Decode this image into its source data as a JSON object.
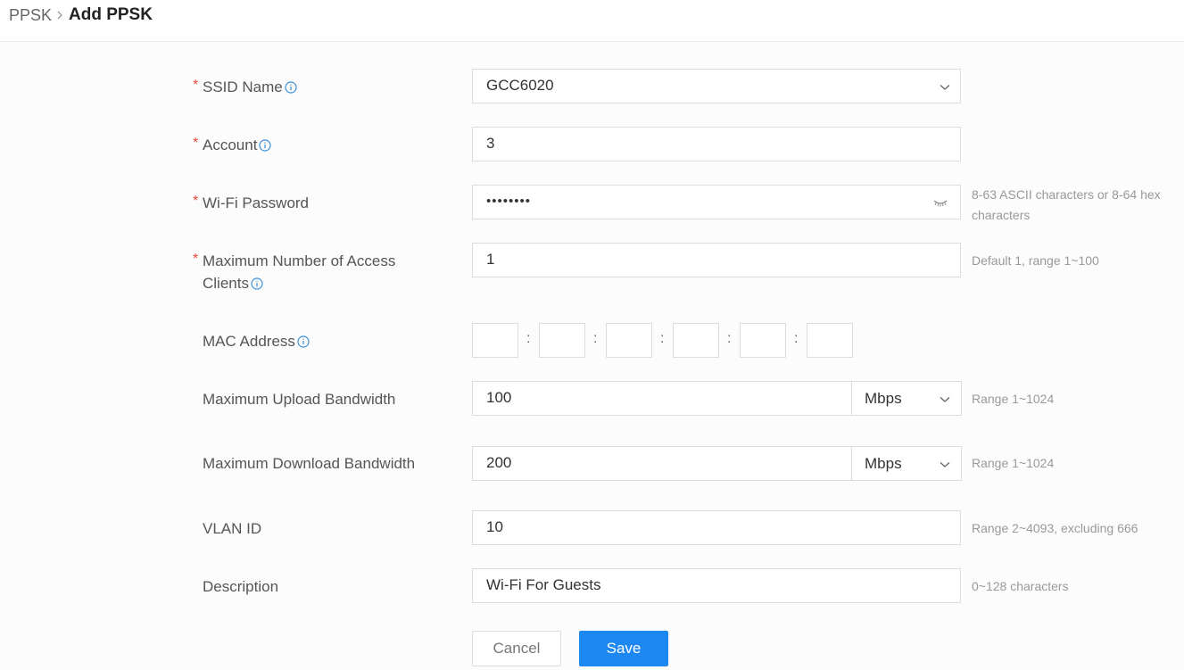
{
  "breadcrumb": {
    "root": "PPSK",
    "current": "Add PPSK"
  },
  "form": {
    "ssid_name": {
      "label": "SSID Name",
      "value": "GCC6020"
    },
    "account": {
      "label": "Account",
      "value": "3"
    },
    "wifi_password": {
      "label": "Wi-Fi Password",
      "value": "••••••••",
      "hint": [
        "8-63 ASCII characters or 8-64 hex",
        "characters"
      ]
    },
    "max_clients": {
      "label_line1": "Maximum Number of Access",
      "label_line2": "Clients",
      "value": "1",
      "hint": "Default 1, range 1~100"
    },
    "mac_address": {
      "label": "MAC Address",
      "separator": ":"
    },
    "upload_bandwidth": {
      "label": "Maximum Upload Bandwidth",
      "value": "100",
      "unit": "Mbps",
      "hint": "Range 1~1024"
    },
    "download_bandwidth": {
      "label": "Maximum Download Bandwidth",
      "value": "200",
      "unit": "Mbps",
      "hint": "Range 1~1024"
    },
    "vlan_id": {
      "label": "VLAN ID",
      "value": "10",
      "hint": "Range 2~4093, excluding 666"
    },
    "description": {
      "label": "Description",
      "value": "Wi-Fi For Guests",
      "hint": "0~128 characters"
    },
    "required_mark": "*"
  },
  "actions": {
    "cancel_label": "Cancel",
    "save_label": "Save"
  },
  "colors": {
    "accent": "#1e88f2",
    "required": "#e74c3c",
    "info_icon": "#3b8fd6"
  },
  "icons": {
    "breadcrumb_separator": "chevron-right-icon",
    "info": "info-circle-icon",
    "dropdown": "chevron-down-icon",
    "password_toggle": "eye-closed-icon"
  }
}
